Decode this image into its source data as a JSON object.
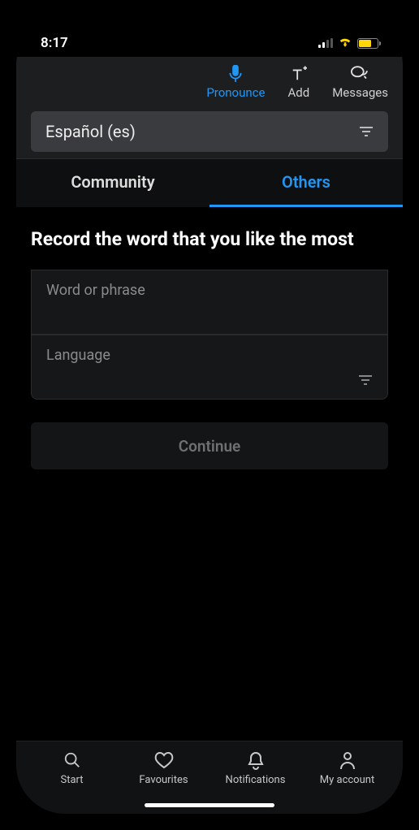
{
  "status": {
    "time": "8:17"
  },
  "top_actions": {
    "pronounce": "Pronounce",
    "add": "Add",
    "messages": "Messages"
  },
  "lang_selector": {
    "label": "Español (es)"
  },
  "tabs": {
    "community": "Community",
    "others": "Others"
  },
  "heading": "Record the word that you like the most",
  "form": {
    "word_label": "Word or phrase",
    "language_label": "Language",
    "continue": "Continue"
  },
  "nav": {
    "start": "Start",
    "favourites": "Favourites",
    "notifications": "Notifications",
    "account": "My account"
  }
}
